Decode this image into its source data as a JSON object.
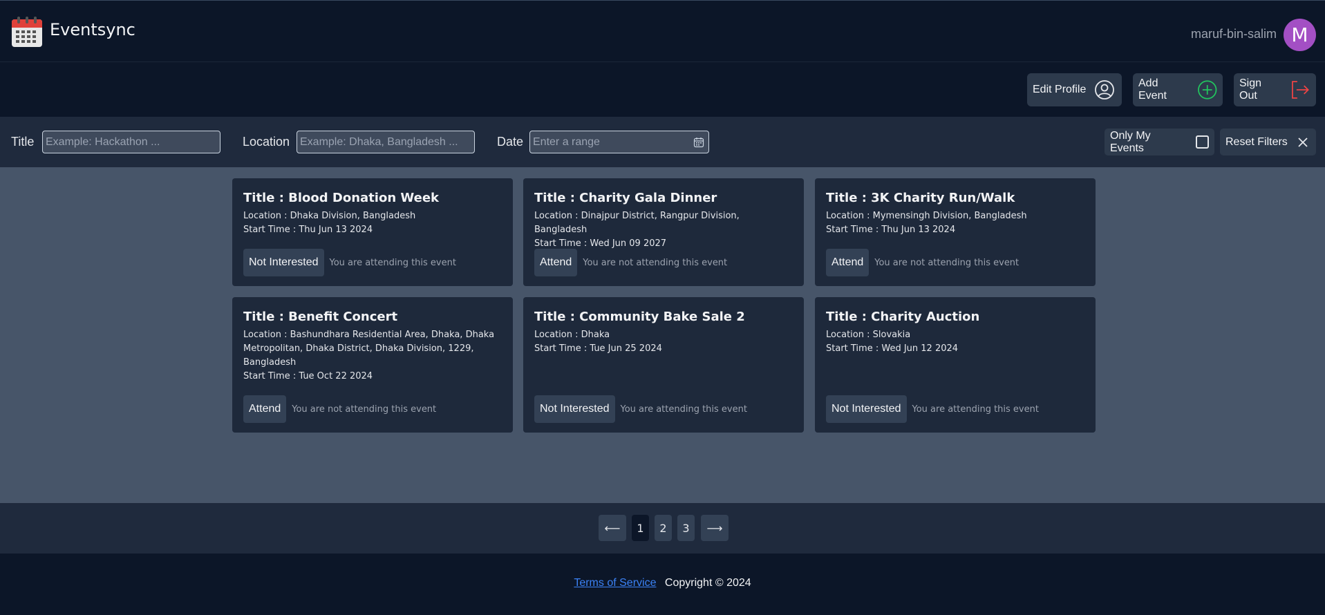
{
  "app": {
    "brand": "Eventsync",
    "username": "maruf-bin-salim",
    "avatar_letter": "M"
  },
  "actions": {
    "edit_profile": "Edit Profile",
    "add_event": "Add Event",
    "sign_out": "Sign Out"
  },
  "filters": {
    "title_label": "Title",
    "title_placeholder": "Example: Hackathon ...",
    "location_label": "Location",
    "location_placeholder": "Example: Dhaka, Bangladesh ...",
    "date_label": "Date",
    "date_placeholder": "Enter a range",
    "only_my_events": "Only My Events",
    "reset_filters": "Reset Filters"
  },
  "events": [
    {
      "title": "Title : Blood Donation Week",
      "location": "Location : Dhaka Division, Bangladesh",
      "start": "Start Time : Thu Jun 13 2024",
      "button": "Not Interested",
      "status": "You are attending this event"
    },
    {
      "title": "Title : Charity Gala Dinner",
      "location": "Location : Dinajpur District, Rangpur Division, Bangladesh",
      "start": "Start Time : Wed Jun 09 2027",
      "button": "Attend",
      "status": "You are not attending this event"
    },
    {
      "title": "Title : 3K Charity Run/Walk",
      "location": "Location : Mymensingh Division, Bangladesh",
      "start": "Start Time : Thu Jun 13 2024",
      "button": "Attend",
      "status": "You are not attending this event"
    },
    {
      "title": "Title : Benefit Concert",
      "location": "Location : Bashundhara Residential Area, Dhaka, Dhaka Metropolitan, Dhaka District, Dhaka Division, 1229, Bangladesh",
      "start": "Start Time : Tue Oct 22 2024",
      "button": "Attend",
      "status": "You are not attending this event"
    },
    {
      "title": "Title : Community Bake Sale 2",
      "location": "Location : Dhaka",
      "start": "Start Time : Tue Jun 25 2024",
      "button": "Not Interested",
      "status": "You are attending this event"
    },
    {
      "title": "Title : Charity Auction",
      "location": "Location : Slovakia",
      "start": "Start Time : Wed Jun 12 2024",
      "button": "Not Interested",
      "status": "You are attending this event"
    }
  ],
  "pagination": {
    "prev": "⟵",
    "pages": [
      "1",
      "2",
      "3"
    ],
    "current": "1",
    "next": "⟶"
  },
  "footer": {
    "terms": "Terms of Service",
    "copyright": "Copyright © 2024"
  },
  "colors": {
    "accent_add": "#22c55e",
    "accent_signout": "#ef4444",
    "avatar": "#a34fc4",
    "link": "#3b82f6"
  }
}
